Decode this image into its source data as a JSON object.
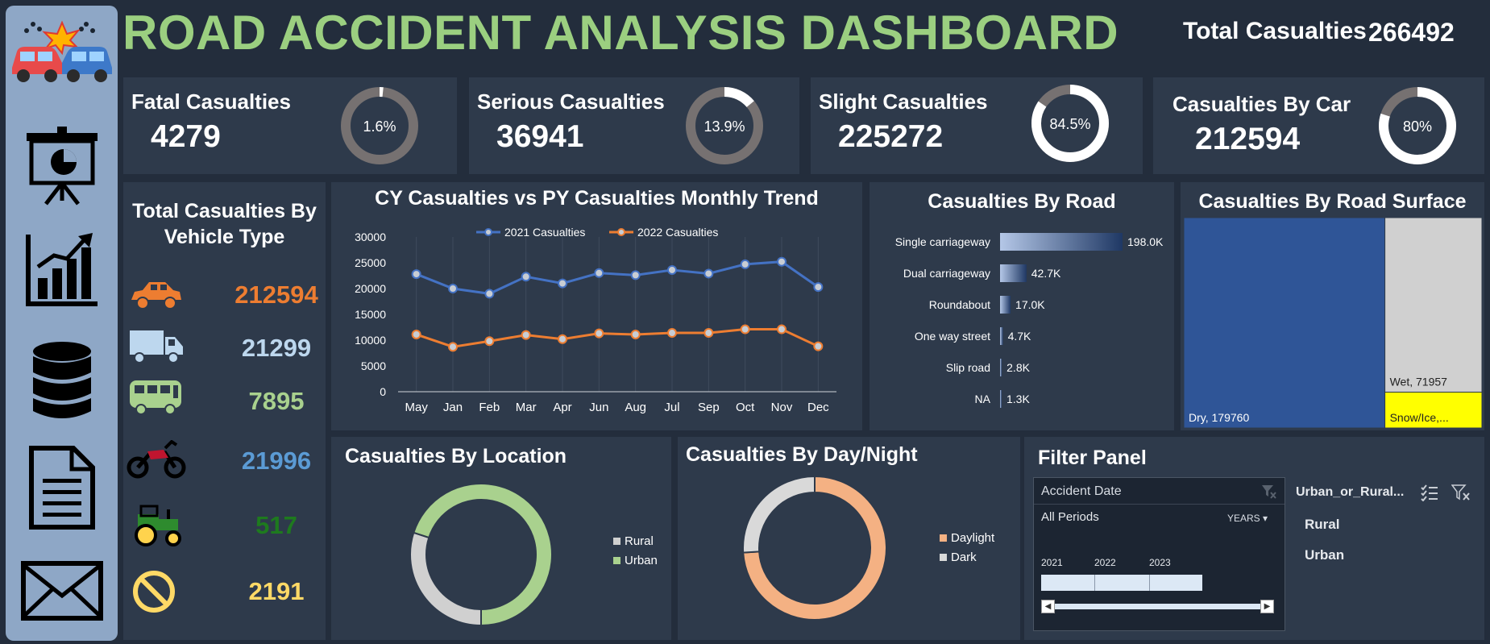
{
  "dashboard": {
    "title": "ROAD ACCIDENT ANALYSIS DASHBOARD",
    "total_label": "Total Casualties",
    "total_value": "266492"
  },
  "sidebar": {
    "icons": [
      "car-crash-icon",
      "presentation-icon",
      "bar-chart-icon",
      "database-icon",
      "document-icon",
      "mail-icon"
    ]
  },
  "kpis": [
    {
      "label": "Fatal Casualties",
      "value": "4279",
      "pct_label": "1.6%",
      "pct": 1.6
    },
    {
      "label": "Serious Casualties",
      "value": "36941",
      "pct_label": "13.9%",
      "pct": 13.9
    },
    {
      "label": "Slight Casualties",
      "value": "225272",
      "pct_label": "84.5%",
      "pct": 84.5
    },
    {
      "label": "Casualties By Car",
      "value": "212594",
      "pct_label": "80%",
      "pct": 80
    }
  ],
  "vehicles": {
    "title": "Total Casualties By Vehicle Type",
    "items": [
      {
        "icon": "car-icon",
        "value": "212594",
        "color": "#ed7d31"
      },
      {
        "icon": "van-icon",
        "value": "21299",
        "color": "#bdd7ee"
      },
      {
        "icon": "bus-icon",
        "value": "7895",
        "color": "#a9d18e"
      },
      {
        "icon": "motorcycle-icon",
        "value": "21996",
        "color": "#5b9bd5"
      },
      {
        "icon": "tractor-icon",
        "value": "517",
        "color": "#1e7a1e"
      },
      {
        "icon": "other-icon",
        "value": "2191",
        "color": "#ffd966"
      }
    ]
  },
  "filter_panel": {
    "title": "Filter Panel",
    "date_header": "Accident Date",
    "all_periods": "All Periods",
    "period_unit": "YEARS",
    "years": [
      "2021",
      "2022",
      "2023"
    ],
    "slicer_header": "Urban_or_Rural...",
    "slicer_items": [
      "Rural",
      "Urban"
    ]
  },
  "chart_data": [
    {
      "type": "line",
      "title": "CY Casualties vs PY Casualties Monthly Trend",
      "categories": [
        "May",
        "Jan",
        "Feb",
        "Mar",
        "Apr",
        "Jun",
        "Aug",
        "Jul",
        "Sep",
        "Oct",
        "Nov",
        "Dec"
      ],
      "series": [
        {
          "name": "2021 Casualties",
          "color": "#4472c4",
          "values": [
            22800,
            20000,
            19000,
            22300,
            21000,
            23000,
            22600,
            23600,
            22900,
            24700,
            25200,
            20300
          ]
        },
        {
          "name": "2022 Casualties",
          "color": "#ed7d31",
          "values": [
            11100,
            8700,
            9800,
            11000,
            10200,
            11300,
            11100,
            11400,
            11400,
            12100,
            12100,
            8800
          ]
        }
      ],
      "yticks": [
        "30000",
        "25000",
        "20000",
        "15000",
        "10000",
        "5000",
        "0"
      ],
      "ylim": [
        0,
        30000
      ],
      "grid": false,
      "legend": "top"
    },
    {
      "type": "bar",
      "title": "Casualties By Road",
      "categories": [
        "Single carriageway",
        "Dual carriageway",
        "Roundabout",
        "One way street",
        "Slip road",
        "NA"
      ],
      "values": [
        198.0,
        42.7,
        17.0,
        4.7,
        2.8,
        1.3
      ],
      "value_labels": [
        "198.0K",
        "42.7K",
        "17.0K",
        "4.7K",
        "2.8K",
        "1.3K"
      ]
    },
    {
      "type": "treemap",
      "title": "Casualties By Road Surface",
      "items": [
        {
          "label": "Dry, 179760",
          "value": 179760,
          "color": "#2f5597"
        },
        {
          "label": "Wet, 71957",
          "value": 71957,
          "color": "#d0d0d0"
        },
        {
          "label": "Snow/Ice,...",
          "value": 14775,
          "color": "#ffff00"
        }
      ]
    },
    {
      "type": "pie",
      "title": "Casualties By Location",
      "items": [
        {
          "name": "Rural",
          "value": 30,
          "color": "#d0d0d0"
        },
        {
          "name": "Urban",
          "value": 70,
          "color": "#a9d18e"
        }
      ]
    },
    {
      "type": "pie",
      "title": "Casualties By Day/Night",
      "items": [
        {
          "name": "Daylight",
          "value": 74,
          "color": "#f4b183"
        },
        {
          "name": "Dark",
          "value": 26,
          "color": "#d9d9d9"
        }
      ]
    }
  ]
}
